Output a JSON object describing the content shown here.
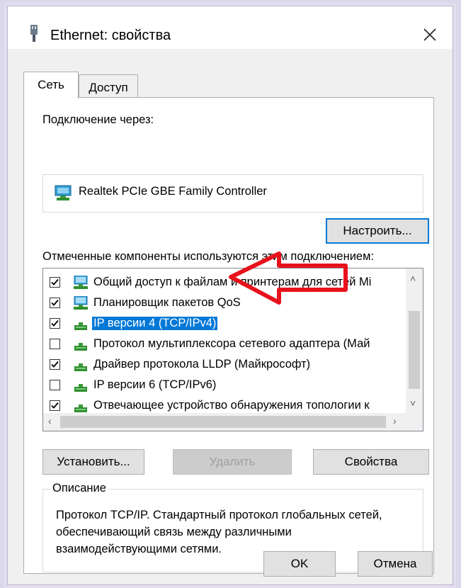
{
  "window": {
    "title": "Ethernet: свойства"
  },
  "tabs": [
    {
      "label": "Сеть",
      "active": true
    },
    {
      "label": "Доступ",
      "active": false
    }
  ],
  "connection": {
    "label": "Подключение через:",
    "adapter": "Realtek PCIe GBE Family Controller",
    "configure_button": "Настроить..."
  },
  "components": {
    "label": "Отмеченные компоненты используются этим подключением:",
    "items": [
      {
        "text": "Общий доступ к файлам и принтерам для сетей Mi",
        "checked": true,
        "icon": "network-service-icon"
      },
      {
        "text": "Планировщик пакетов QoS",
        "checked": true,
        "icon": "network-service-icon"
      },
      {
        "text": "IP версии 4 (TCP/IPv4)",
        "checked": true,
        "icon": "protocol-icon",
        "selected": true
      },
      {
        "text": "Протокол мультиплексора сетевого адаптера (Май",
        "checked": false,
        "icon": "protocol-icon"
      },
      {
        "text": "Драйвер протокола LLDP (Майкрософт)",
        "checked": true,
        "icon": "protocol-icon"
      },
      {
        "text": "IP версии 6 (TCP/IPv6)",
        "checked": false,
        "icon": "protocol-icon"
      },
      {
        "text": "Отвечающее устройство обнаружения топологии к",
        "checked": true,
        "icon": "protocol-icon"
      }
    ]
  },
  "buttons": {
    "install": "Установить...",
    "remove": "Удалить",
    "properties": "Свойства",
    "ok": "OK",
    "cancel": "Отмена"
  },
  "description": {
    "label": "Описание",
    "text": "Протокол TCP/IP. Стандартный протокол глобальных сетей, обеспечивающий связь между различными взаимодействующими сетями."
  },
  "colors": {
    "selection": "#0078d7",
    "annotation_arrow": "#e8121c",
    "focus_border": "#0078d7"
  }
}
